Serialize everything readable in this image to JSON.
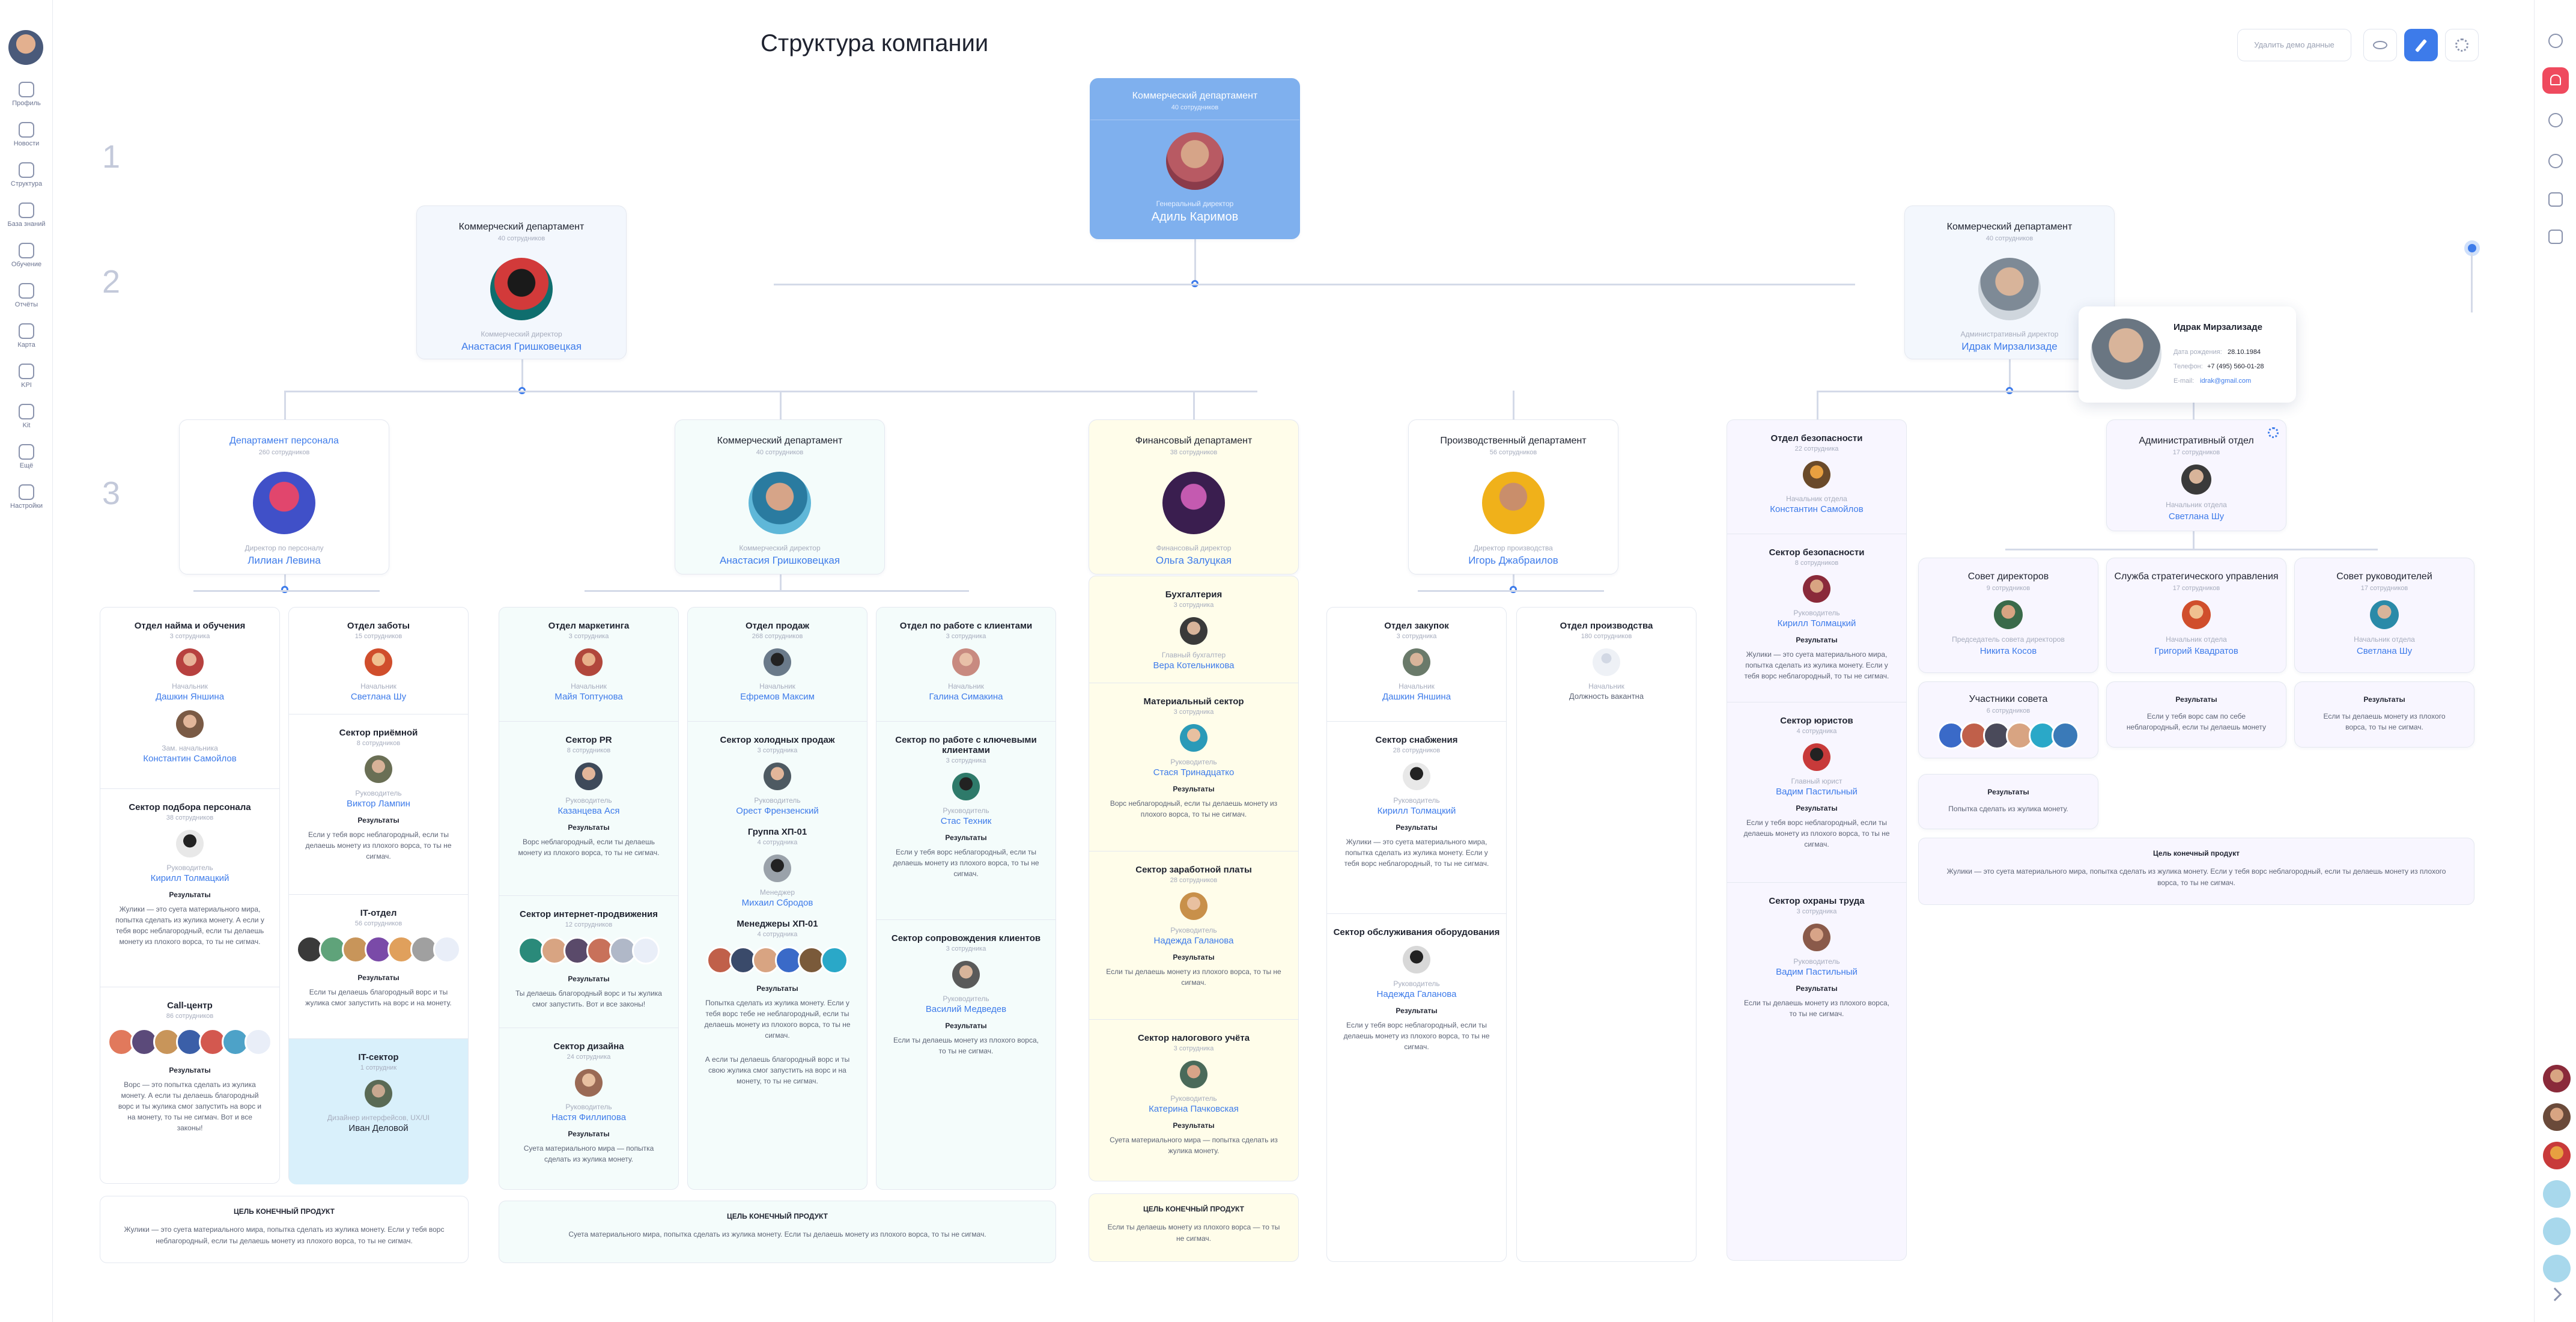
{
  "page_title": "Структура компании",
  "levels": [
    "1",
    "2",
    "3"
  ],
  "top_buttons": {
    "delete_demo": "Удалить демо данные"
  },
  "sidebar": [
    {
      "label": "Профиль",
      "icon": "user-icon"
    },
    {
      "label": "Новости",
      "icon": "bookmark-icon"
    },
    {
      "label": "Структура",
      "icon": "structure-icon"
    },
    {
      "label": "База знаний",
      "icon": "search-icon"
    },
    {
      "label": "Обучение",
      "icon": "graduation-icon"
    },
    {
      "label": "Отчёты",
      "icon": "chart-icon"
    },
    {
      "label": "Карта",
      "icon": "map-icon"
    },
    {
      "label": "KPI",
      "icon": "gauge-icon"
    },
    {
      "label": "Kit",
      "icon": "kit-icon"
    },
    {
      "label": "Ещё",
      "icon": "more-icon"
    },
    {
      "label": "Настройки",
      "icon": "settings-icon"
    }
  ],
  "root": {
    "title": "Коммерческий департамент",
    "count": "40 сотрудников",
    "role": "Генеральный директор",
    "name": "Адиль Каримов"
  },
  "lvl2_left": {
    "title": "Коммерческий департамент",
    "count": "40 сотрудников",
    "role": "Коммерческий директор",
    "name": "Анастасия Гришковецкая"
  },
  "lvl2_right": {
    "title": "Коммерческий департамент",
    "count": "40 сотрудников",
    "role": "Административный директор",
    "name": "Идрак Мирзализаде"
  },
  "popup": {
    "name": "Идрак Мирзализаде",
    "dob_label": "Дата рождения:",
    "dob": "28.10.1984",
    "phone_label": "Телефон:",
    "phone": "+7 (495) 560-01-28",
    "email_label": "E-mail:",
    "email": "idrak@gmail.com"
  },
  "departments": [
    {
      "title": "Департамент персонала",
      "count": "260 сотрудников",
      "role": "Директор по персоналу",
      "name": "Лилиан Левина"
    },
    {
      "title": "Коммерческий департамент",
      "count": "40 сотрудников",
      "role": "Коммерческий директор",
      "name": "Анастасия Гришковецкая"
    },
    {
      "title": "Финансовый департамент",
      "count": "38 сотрудников",
      "role": "Финансовый директор",
      "name": "Ольга Залуцкая"
    },
    {
      "title": "Производственный департамент",
      "count": "56 сотрудников",
      "role": "Директор производства",
      "name": "Игорь Джабраилов"
    }
  ],
  "col1": [
    {
      "title": "Отдел найма и обучения",
      "count": "3 сотрудника",
      "r1": "Начальник",
      "n1": "Дашкин Яншина",
      "r2": "Зам. начальника",
      "n2": "Константин Самойлов"
    },
    {
      "title": "Сектор подбора персонала",
      "count": "38 сотрудников",
      "role": "Руководитель",
      "name": "Кирилл Толмацкий",
      "res_h": "Результаты",
      "res": "Жулики — это суета материального мира, попытка сделать из жулика монету. А если у тебя ворс неблагородный, если ты делаешь монету из плохого ворса, то ты не сигмач."
    },
    {
      "title": "Call-центр",
      "count": "86 сотрудников",
      "res_h": "Результаты",
      "res": "Ворс — это попытка сделать из жулика монету. А если ты делаешь благородный ворс и ты жулика смог запустить на ворс и на монету, то ты не сигмач. Вот и все законы!"
    }
  ],
  "col2": [
    {
      "title": "Отдел заботы",
      "count": "15 сотрудников",
      "role": "Начальник",
      "name": "Светлана Шу"
    },
    {
      "title": "Сектор приёмной",
      "count": "8 сотрудников",
      "role": "Руководитель",
      "name": "Виктор Лампин",
      "res_h": "Результаты",
      "res": "Если у тебя ворс неблагородный, если ты делаешь монету из плохого ворса, то ты не сигмач."
    },
    {
      "title": "IT-отдел",
      "count": "56 сотрудников",
      "res_h": "Результаты",
      "res": "Если ты делаешь благородный ворс и ты жулика смог запустить на ворс и на монету."
    },
    {
      "title": "IT-сектор",
      "count": "1 сотрудник",
      "role": "Дизайнер интерфейсов, UX/UI",
      "name": "Иван Деловой"
    }
  ],
  "goal_personnel": {
    "h": "ЦЕЛЬ КОНЕЧНЫЙ ПРОДУКТ",
    "t": "Жулики — это суета материального мира, попытка сделать из жулика монету. Если у тебя ворс неблагородный, если ты делаешь монету из плохого ворса, то ты не сигмач."
  },
  "col3": [
    {
      "title": "Отдел маркетинга",
      "count": "3 сотрудника",
      "role": "Начальник",
      "name": "Майя Топтунова"
    },
    {
      "title": "Сектор PR",
      "count": "8 сотрудников",
      "role": "Руководитель",
      "name": "Казанцева Ася",
      "res_h": "Результаты",
      "res": "Ворс неблагородный, если ты делаешь монету из плохого ворса, то ты не сигмач."
    },
    {
      "title": "Сектор интернет-продвижения",
      "count": "12 сотрудников",
      "res_h": "Результаты",
      "res": "Ты делаешь благородный ворс и ты жулика смог запустить. Вот и все законы!"
    },
    {
      "title": "Сектор дизайна",
      "count": "24 сотрудника",
      "role": "Руководитель",
      "name": "Настя Филлипова",
      "res_h": "Результаты",
      "res": "Суета материального мира — попытка сделать из жулика монету."
    }
  ],
  "col4": [
    {
      "title": "Отдел продаж",
      "count": "268 сотрудников",
      "role": "Начальник",
      "name": "Ефремов Максим"
    },
    {
      "title": "Сектор холодных продаж",
      "count": "3 сотрудника",
      "role": "Руководитель",
      "name": "Орест Френзенский"
    },
    {
      "title": "Группа ХП-01",
      "count": "4 сотрудника",
      "role": "Менеджер",
      "name": "Михаил Сбродов"
    },
    {
      "title": "Менеджеры ХП-01",
      "count": "4 сотрудника",
      "res_h": "Результаты",
      "res": "Попытка сделать из жулика монету. Если у тебя ворс тебе не неблагородный, если ты делаешь монету из плохого ворса, то ты не сигмач."
    },
    {
      "res2": "А если ты делаешь благородный ворс и ты свою жулика смог запустить на ворс и на монету, то ты не сигмач."
    }
  ],
  "col5": [
    {
      "title": "Отдел по работе с клиентами",
      "count": "3 сотрудника",
      "role": "Начальник",
      "name": "Галина Симакина"
    },
    {
      "title": "Сектор по работе с ключевыми клиентами",
      "count": "3 сотрудника",
      "role": "Руководитель",
      "name": "Стас Техник",
      "res_h": "Результаты",
      "res": "Если у тебя ворс неблагородный, если ты делаешь монету из плохого ворса, то ты не сигмач."
    },
    {
      "title": "Сектор сопровождения клиентов",
      "count": "3 сотрудника",
      "role": "Руководитель",
      "name": "Василий Медведев",
      "res_h": "Результаты",
      "res": "Если ты делаешь монету из плохого ворса, то ты не сигмач."
    }
  ],
  "goal_commercial": {
    "h": "ЦЕЛЬ КОНЕЧНЫЙ ПРОДУКТ",
    "t": "Суета материального мира, попытка сделать из жулика монету. Если ты делаешь монету из плохого ворса, то ты не сигмач."
  },
  "col6": [
    {
      "title": "Бухгалтерия",
      "count": "3 сотрудника",
      "role": "Главный бухгалтер",
      "name": "Вера Котельникова"
    },
    {
      "title": "Материальный сектор",
      "count": "3 сотрудника",
      "role": "Руководитель",
      "name": "Стася Тринадцатко",
      "res_h": "Результаты",
      "res": "Ворс неблагородный, если ты делаешь монету из плохого ворса, то ты не сигмач."
    },
    {
      "title": "Сектор заработной платы",
      "count": "28 сотрудников",
      "role": "Руководитель",
      "name": "Надежда Галанова",
      "res_h": "Результаты",
      "res": "Если ты делаешь монету из плохого ворса, то ты не сигмач."
    },
    {
      "title": "Сектор налогового учёта",
      "count": "3 сотрудника",
      "role": "Руководитель",
      "name": "Катерина Пачковская",
      "res_h": "Результаты",
      "res": "Суета материального мира — попытка сделать из жулика монету."
    }
  ],
  "goal_finance": {
    "h": "ЦЕЛЬ КОНЕЧНЫЙ ПРОДУКТ",
    "t": "Если ты делаешь монету из плохого ворса — то ты не сигмач."
  },
  "col7": [
    {
      "title": "Отдел закупок",
      "count": "3 сотрудника",
      "role": "Начальник",
      "name": "Дашкин Яншина"
    },
    {
      "title": "Сектор снабжения",
      "count": "28 сотрудников",
      "role": "Руководитель",
      "name": "Кирилл Толмацкий",
      "res_h": "Результаты",
      "res": "Жулики — это суета материального мира, попытка сделать из жулика монету. Если у тебя ворс неблагородный, то ты не сигмач."
    },
    {
      "title": "Сектор обслуживания оборудования",
      "count": "",
      "role": "Руководитель",
      "name": "Надежда Галанова",
      "res_h": "Результаты",
      "res": "Если у тебя ворс неблагородный, если ты делаешь монету из плохого ворса, то ты не сигмач."
    }
  ],
  "col8": [
    {
      "title": "Отдел производства",
      "count": "180 сотрудников",
      "role": "Начальник",
      "name": "Должность вакантна"
    }
  ],
  "col9": [
    {
      "title": "Отдел безопасности",
      "count": "22 сотрудника",
      "role": "Начальник отдела",
      "name": "Константин Самойлов"
    },
    {
      "title": "Сектор безопасности",
      "count": "8 сотрудников",
      "role": "Руководитель",
      "name": "Кирилл Толмацкий",
      "res_h": "Результаты",
      "res": "Жулики — это суета материального мира, попытка сделать из жулика монету. Если у тебя ворс неблагородный, то ты не сигмач."
    },
    {
      "title": "Сектор юристов",
      "count": "4 сотрудника",
      "role": "Главный юрист",
      "name": "Вадим Пастильный",
      "res_h": "Результаты",
      "res": "Если у тебя ворс неблагородный, если ты делаешь монету из плохого ворса, то ты не сигмач."
    },
    {
      "title": "Сектор охраны труда",
      "count": "3 сотрудника",
      "role": "Руководитель",
      "name": "Вадим Пастильный",
      "res_h": "Результаты",
      "res": "Если ты делаешь монету из плохого ворса, то ты не сигмач."
    }
  ],
  "admin": {
    "title": "Административный отдел",
    "count": "17 сотрудников",
    "role": "Начальник отдела",
    "name": "Светлана Шу"
  },
  "admin_sub": [
    {
      "title": "Совет директоров",
      "count": "9 сотрудников",
      "role": "Председатель совета директоров",
      "name": "Никита Косов"
    },
    {
      "title": "Служба стратегического управления",
      "count": "17 сотрудников",
      "role": "Начальник отдела",
      "name": "Григорий Квадратов"
    },
    {
      "title": "Совет руководителей",
      "count": "17 сотрудников",
      "role": "Начальник отдела",
      "name": "Светлана Шу"
    }
  ],
  "council": {
    "title": "Участники совета",
    "count": "6 сотрудников"
  },
  "admin_res": [
    {
      "h": "Результаты",
      "t": "Попытка сделать из жулика монету."
    },
    {
      "h": "Результаты",
      "t": "Если у тебя ворс сам по себе неблагородный, если ты делаешь монету"
    },
    {
      "h": "Результаты",
      "t": "Если ты делаешь монету из плохого ворса, то ты не сигмач."
    }
  ],
  "goal_admin": {
    "h": "Цель конечный продукт",
    "t": "Жулики — это суета материального мира, попытка сделать из жулика монету. Если у тебя ворс неблагородный, если ты делаешь монету из плохого ворса, то ты не сигмач."
  },
  "colors": {
    "accent": "#3d7bea",
    "root_bg": "#7fb0ee",
    "finance_bg": "#fffdea",
    "admin_bg": "#f8f6ff",
    "it_bg": "#d9f0fb",
    "commercial_bg": "#f4fcfb"
  }
}
